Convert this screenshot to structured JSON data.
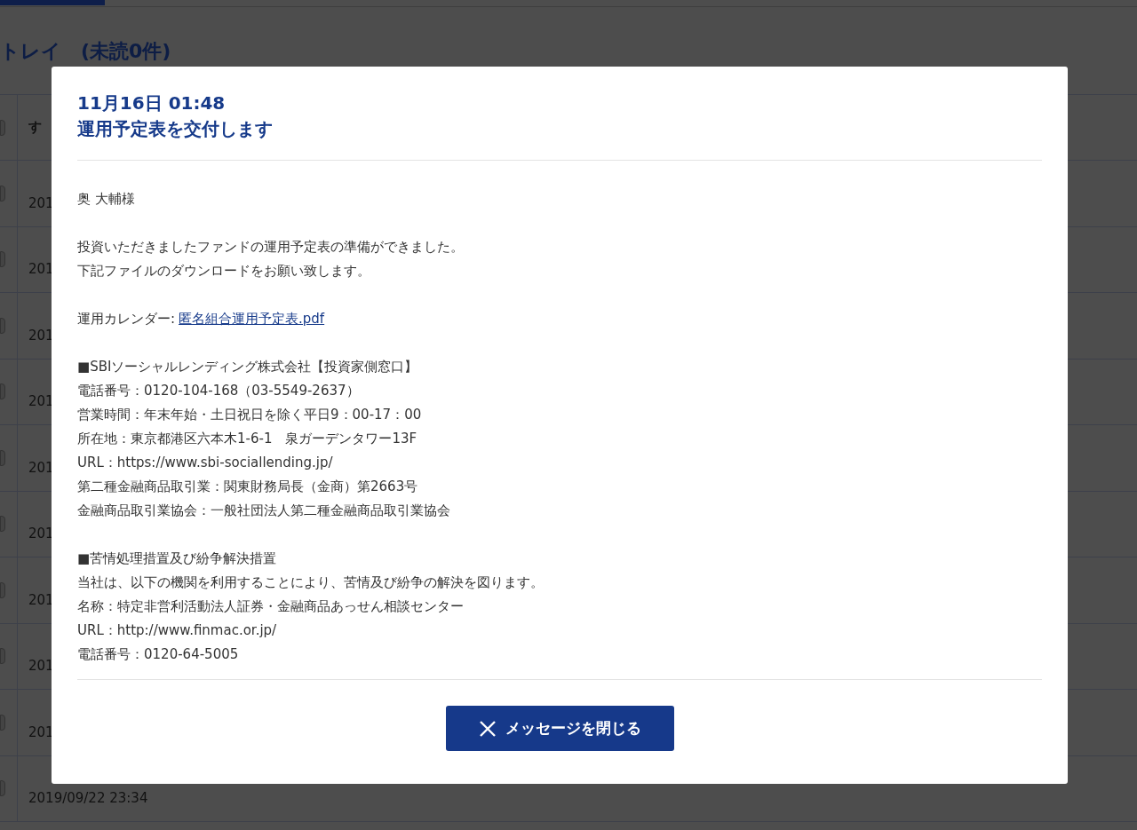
{
  "page": {
    "heading": "トレイ　(未読0件)",
    "table": {
      "header": {
        "text": "す",
        "checked": false
      },
      "rows": [
        {
          "date": "201",
          "checked": false
        },
        {
          "date": "201",
          "checked": false
        },
        {
          "date": "201",
          "checked": false
        },
        {
          "date": "201",
          "checked": false
        },
        {
          "date": "201",
          "checked": false
        },
        {
          "date": "201",
          "checked": false
        },
        {
          "date": "201",
          "checked": false
        },
        {
          "date": "201",
          "checked": false
        },
        {
          "date": "201",
          "checked": false
        },
        {
          "date": "2019/09/22 23:34",
          "checked": false
        }
      ]
    }
  },
  "modal": {
    "datetime": "11月16日 01:48",
    "title": "運用予定表を交付します",
    "blocks": [
      {
        "lines": [
          {
            "kind": "text",
            "text": "奥 大輔様"
          }
        ]
      },
      {
        "lines": [
          {
            "kind": "text",
            "text": "投資いただきましたファンドの運用予定表の準備ができました。"
          },
          {
            "kind": "text",
            "text": "下記ファイルのダウンロードをお願い致します。"
          }
        ]
      },
      {
        "lines": [
          {
            "kind": "link",
            "text": "運用カレンダー:",
            "link": "匿名組合運用予定表.pdf"
          }
        ]
      },
      {
        "lines": [
          {
            "kind": "text",
            "text": "■SBIソーシャルレンディング株式会社【投資家側窓口】"
          },
          {
            "kind": "text",
            "text": "電話番号：0120-104-168（03-5549-2637）"
          },
          {
            "kind": "text",
            "text": "営業時間：年末年始・土日祝日を除く平日9：00-17：00"
          },
          {
            "kind": "text",
            "text": "所在地：東京都港区六本木1-6-1　泉ガーデンタワー13F"
          },
          {
            "kind": "text",
            "text": "URL：https://www.sbi-sociallending.jp/"
          },
          {
            "kind": "text",
            "text": "第二種金融商品取引業：関東財務局長（金商）第2663号"
          },
          {
            "kind": "text",
            "text": "金融商品取引業協会：一般社団法人第二種金融商品取引業協会"
          }
        ]
      },
      {
        "lines": [
          {
            "kind": "text",
            "text": "■苦情処理措置及び紛争解決措置"
          },
          {
            "kind": "text",
            "text": "当社は、以下の機関を利用することにより、苦情及び紛争の解決を図ります。"
          },
          {
            "kind": "text",
            "text": "名称：特定非営利活動法人証券・金融商品あっせん相談センター"
          },
          {
            "kind": "text",
            "text": "URL：http://www.finmac.or.jp/"
          },
          {
            "kind": "text",
            "text": "電話番号：0120-64-5005"
          }
        ]
      }
    ],
    "close_button": "メッセージを閉じる"
  }
}
